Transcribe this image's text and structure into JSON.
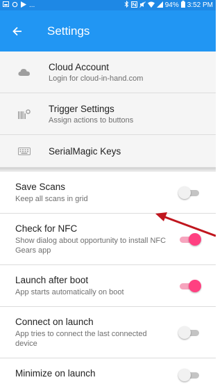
{
  "status_bar": {
    "left_icons": [
      "gallery-icon",
      "sync-icon",
      "play-icon"
    ],
    "ellipsis": "...",
    "battery": "94%",
    "time": "3:52 PM"
  },
  "app_bar": {
    "title": "Settings",
    "color": "#2196f3"
  },
  "nav_items": [
    {
      "icon": "cloud-icon",
      "title": "Cloud Account",
      "subtitle": "Login for cloud-in-hand.com"
    },
    {
      "icon": "barcode-settings-icon",
      "title": "Trigger Settings",
      "subtitle": "Assign actions to buttons"
    },
    {
      "icon": "keyboard-icon",
      "title": "SerialMagic Keys"
    }
  ],
  "preferences": [
    {
      "title": "Save Scans",
      "subtitle": "Keep all scans in grid",
      "enabled": false
    },
    {
      "title": "Check for NFC",
      "subtitle": "Show dialog about opportunity to install NFC Gears app",
      "enabled": true
    },
    {
      "title": "Launch after boot",
      "subtitle": "App starts automatically on boot",
      "enabled": true
    },
    {
      "title": "Connect on launch",
      "subtitle": "App tries to connect the last connected device",
      "enabled": false
    },
    {
      "title": "Minimize on launch",
      "enabled": false
    }
  ],
  "colors": {
    "switch_on": "#ff4081",
    "annotation_arrow": "#c0161e"
  }
}
